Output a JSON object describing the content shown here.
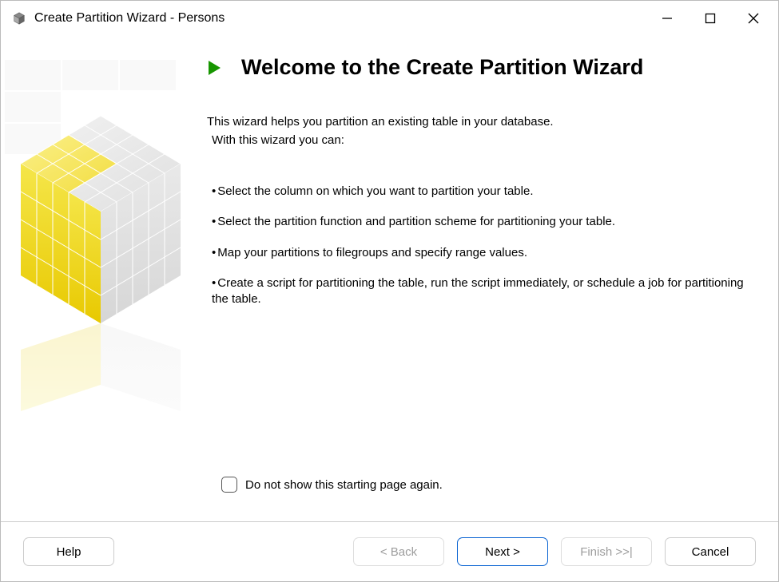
{
  "window": {
    "title": "Create Partition Wizard - Persons"
  },
  "heading": "Welcome to the Create Partition Wizard",
  "intro": {
    "line1": "This wizard helps you partition an existing table in your database.",
    "line2": "With this wizard you can:"
  },
  "bullets": {
    "b0": "Select the column on which you want to partition your table.",
    "b1": "Select the partition function and partition scheme for partitioning your table.",
    "b2": "Map your partitions to filegroups and specify range values.",
    "b3": "Create a script for partitioning the table, run the script immediately, or schedule a job for partitioning the table."
  },
  "checkbox": {
    "label": "Do not show this starting page again."
  },
  "buttons": {
    "help": "Help",
    "back": "< Back",
    "next": "Next >",
    "finish": "Finish >>|",
    "cancel": "Cancel"
  }
}
